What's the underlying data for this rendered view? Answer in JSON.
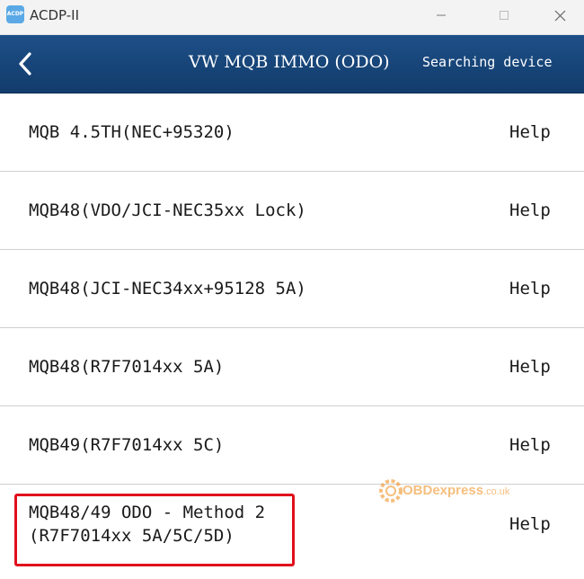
{
  "window": {
    "app_icon_text": "ACDP",
    "title": "ACDP-II"
  },
  "header": {
    "title": "VW MQB IMMO (ODO)",
    "status": "Searching device"
  },
  "menu": {
    "items": [
      {
        "label": "MQB 4.5TH(NEC+95320)",
        "help": "Help"
      },
      {
        "label": "MQB48(VDO/JCI-NEC35xx Lock)",
        "help": "Help"
      },
      {
        "label": "MQB48(JCI-NEC34xx+95128 5A)",
        "help": "Help"
      },
      {
        "label": "MQB48(R7F7014xx 5A)",
        "help": "Help"
      },
      {
        "label": "MQB49(R7F7014xx 5C)",
        "help": "Help"
      },
      {
        "label": "MQB48/49 ODO - Method 2\n(R7F7014xx 5A/5C/5D)",
        "help": "Help"
      }
    ]
  },
  "watermark": {
    "brand": "OBDexpress",
    "domain": ".co.uk"
  },
  "colors": {
    "header_bg": "#1a4a80",
    "highlight_border": "#e0101c",
    "watermark": "#f08a14"
  },
  "icons": {
    "back": "chevron-left-icon",
    "minimize": "minimize-icon",
    "maximize": "maximize-icon",
    "close": "close-icon"
  }
}
